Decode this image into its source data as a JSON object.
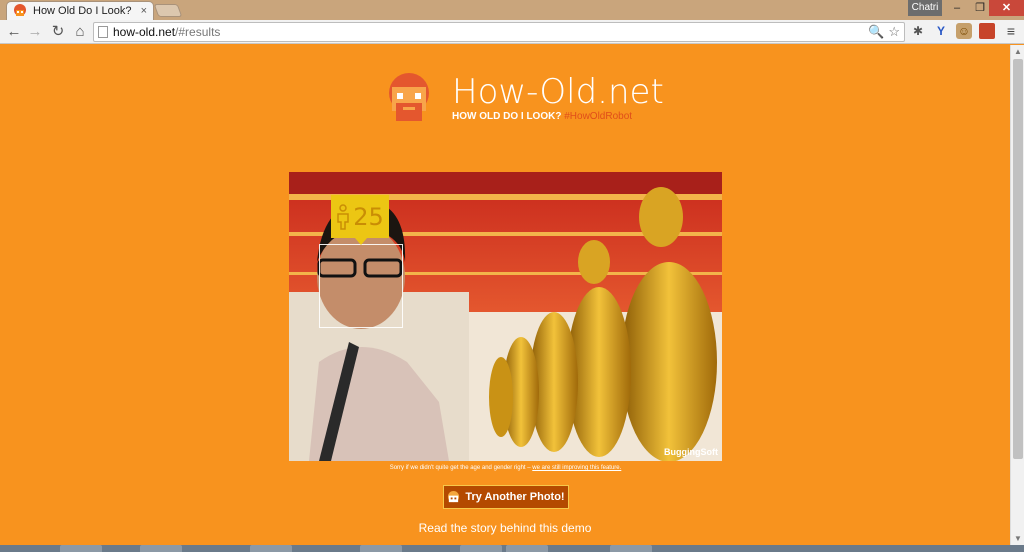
{
  "browser": {
    "tab_title": "How Old Do I Look?",
    "tab_close": "×",
    "profile_name": "Chatri",
    "window_controls": {
      "minimize": "–",
      "maximize": "❐",
      "close": "✕"
    },
    "nav": {
      "back": "←",
      "forward": "→",
      "reload": "↻",
      "home": "⌂"
    },
    "url_host": "how-old.net",
    "url_path": "/#results",
    "omnibox_icons": {
      "search": "🔍",
      "star": "☆"
    },
    "extensions": [
      "puzzle-icon",
      "y-icon",
      "face-icon",
      "book-icon"
    ],
    "menu": "≡"
  },
  "header": {
    "title": "How-Old.net",
    "subtitle": "HOW OLD DO I LOOK?",
    "hashtag": "#HowOldRobot"
  },
  "result": {
    "age": "25",
    "watermark": "BuggingSoft"
  },
  "sorry": {
    "text": "Sorry if we didn't quite get the age and gender right – ",
    "link": "we are still improving this feature."
  },
  "try_button": {
    "label": "Try Another Photo!"
  },
  "story_link": "Read the story behind this demo",
  "colors": {
    "background": "#f8931e",
    "age_tag": "#ecc613",
    "button": "#b44a00",
    "hashtag": "#e04e1a"
  }
}
